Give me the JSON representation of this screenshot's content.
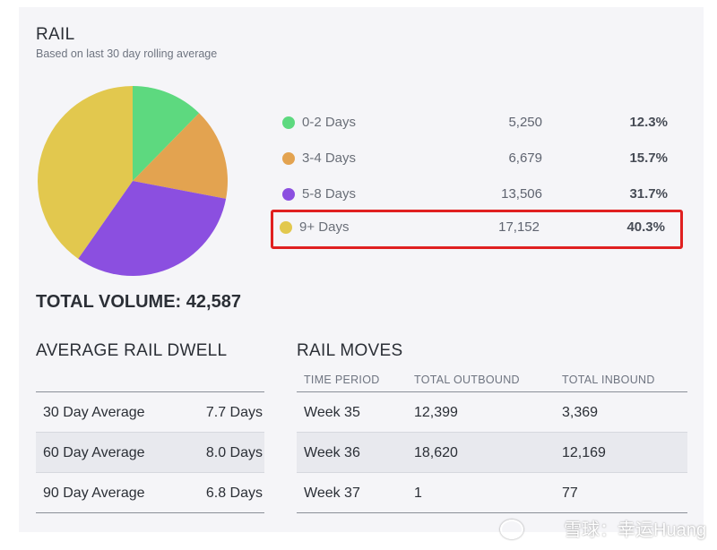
{
  "header": {
    "title": "RAIL",
    "subtitle": "Based on last 30 day rolling average"
  },
  "chart_data": {
    "type": "pie",
    "categories": [
      "0-2 Days",
      "3-4 Days",
      "5-8 Days",
      "9+ Days"
    ],
    "values": [
      5250,
      6679,
      13506,
      17152
    ],
    "percents": [
      "12.3%",
      "15.7%",
      "31.7%",
      "40.3%"
    ],
    "counts_text": [
      "5,250",
      "6,679",
      "13,506",
      "17,152"
    ],
    "colors": [
      "#5dd97f",
      "#e3a350",
      "#8b4fe0",
      "#e2c84e"
    ],
    "highlighted_index": 3
  },
  "total": {
    "text": "TOTAL VOLUME: 42,587"
  },
  "dwell": {
    "title": "AVERAGE RAIL DWELL",
    "rows": [
      {
        "label": "30 Day Average",
        "value": "7.7 Days"
      },
      {
        "label": "60 Day Average",
        "value": "8.0 Days"
      },
      {
        "label": "90 Day Average",
        "value": "6.8 Days"
      }
    ]
  },
  "moves": {
    "title": "RAIL MOVES",
    "headers": [
      "TIME PERIOD",
      "TOTAL OUTBOUND",
      "TOTAL INBOUND"
    ],
    "rows": [
      [
        "Week 35",
        "12,399",
        "3,369"
      ],
      [
        "Week 36",
        "18,620",
        "12,169"
      ],
      [
        "Week 37",
        "1",
        "77"
      ]
    ]
  },
  "watermark": "雪球：幸运Huang"
}
